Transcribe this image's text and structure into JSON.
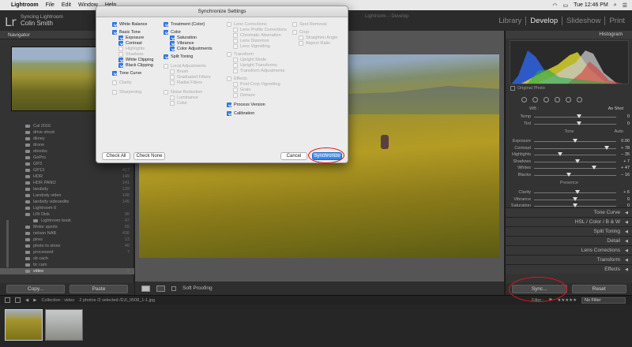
{
  "menubar": {
    "app_name": "Lightroom",
    "items": [
      "File",
      "Edit",
      "Window",
      "Help"
    ],
    "clock": "Tue 12:46 PM"
  },
  "identity": {
    "line1": "Syncing Lightroom",
    "line2": "Colin Smith"
  },
  "window_title_fragment": "Lightroom – Develop",
  "modules": {
    "library": "Library",
    "develop": "Develop",
    "slideshow": "Slideshow",
    "print": "Print"
  },
  "left_panel": {
    "navigator_label": "Navigator",
    "folders": [
      {
        "name": "Cal 2016",
        "count": "",
        "indent": false
      },
      {
        "name": "drive shoot",
        "count": "",
        "indent": false
      },
      {
        "name": "dkney",
        "count": "",
        "indent": false
      },
      {
        "name": "drone",
        "count": "",
        "indent": false
      },
      {
        "name": "ebooks",
        "count": "",
        "indent": false
      },
      {
        "name": "GoPro",
        "count": "",
        "indent": false
      },
      {
        "name": "GP3",
        "count": "",
        "indent": false
      },
      {
        "name": "GP13",
        "count": "417",
        "indent": false
      },
      {
        "name": "HDR",
        "count": "149",
        "indent": false
      },
      {
        "name": "HDR PANO",
        "count": "141",
        "indent": false
      },
      {
        "name": "landsdy",
        "count": "139",
        "indent": false
      },
      {
        "name": "Landsdy video",
        "count": "148",
        "indent": false
      },
      {
        "name": "landsdy videoedits",
        "count": "145",
        "indent": false
      },
      {
        "name": "Lightroom 6",
        "count": "",
        "indent": false
      },
      {
        "name": "LRt Disk",
        "count": "96",
        "indent": false
      },
      {
        "name": "Lightroom book",
        "count": "47",
        "indent": true
      },
      {
        "name": "Motor sports",
        "count": "65",
        "indent": false
      },
      {
        "name": "nelson NAB",
        "count": "436",
        "indent": false
      },
      {
        "name": "pires",
        "count": "13",
        "indent": false
      },
      {
        "name": "photo to show",
        "count": "40",
        "indent": false
      },
      {
        "name": "processed",
        "count": "7",
        "indent": false
      },
      {
        "name": "sb cach",
        "count": "",
        "indent": false
      },
      {
        "name": "tic cam",
        "count": "",
        "indent": false
      },
      {
        "name": "video",
        "count": "2",
        "indent": false,
        "selected": true
      }
    ],
    "copy_button": "Copy...",
    "paste_button": "Paste"
  },
  "toolbar": {
    "soft_proofing": "Soft Proofing"
  },
  "right_panel": {
    "histogram_label": "Histogram",
    "original_photo": "Original Photo",
    "wb_label": "WB :",
    "as_shot": "As Shot",
    "sliders": [
      {
        "label": "Temp",
        "value": "0",
        "pos": 0.55
      },
      {
        "label": "Tint",
        "value": "0",
        "pos": 0.55
      },
      {
        "section": "Tone",
        "auto": "Auto"
      },
      {
        "label": "Exposure",
        "value": "0.00",
        "pos": 0.5
      },
      {
        "label": "Contrast",
        "value": "+ 78",
        "pos": 0.88
      },
      {
        "label": "Highlights",
        "value": "− 35",
        "pos": 0.32
      },
      {
        "label": "Shadows",
        "value": "+ 7",
        "pos": 0.53
      },
      {
        "label": "Whites",
        "value": "+ 47",
        "pos": 0.73
      },
      {
        "label": "Blacks",
        "value": "− 16",
        "pos": 0.42
      },
      {
        "section": "Presence"
      },
      {
        "label": "Clarity",
        "value": "+ 6",
        "pos": 0.53
      },
      {
        "label": "Vibrance",
        "value": "0",
        "pos": 0.5
      },
      {
        "label": "Saturation",
        "value": "0",
        "pos": 0.5
      }
    ],
    "sections": [
      "Tone Curve",
      "HSL / Color / B & W",
      "Split Toning",
      "Detail",
      "Lens Corrections",
      "Transform",
      "Effects"
    ],
    "sync_button": "Sync...",
    "reset_button": "Reset"
  },
  "filmbar": {
    "collection": "Collection : video",
    "selection_info": "2 photos /2 selected /DJI_0508_1-1.jpg",
    "filter_label": "Filter :",
    "filter_value": "No Filter"
  },
  "dialog": {
    "title": "Synchronize Settings",
    "options": [
      {
        "label": "White Balance",
        "checked": true,
        "enabled": true
      },
      {
        "label": "Basic Tone",
        "checked": true,
        "enabled": true
      },
      {
        "label": "Exposure",
        "checked": true,
        "enabled": true
      },
      {
        "label": "Contrast",
        "checked": true,
        "enabled": true
      },
      {
        "label": "Highlights",
        "checked": false,
        "enabled": false
      },
      {
        "label": "Shadows",
        "checked": false,
        "enabled": false
      },
      {
        "label": "White Clipping",
        "checked": true,
        "enabled": true
      },
      {
        "label": "Black Clipping",
        "checked": true,
        "enabled": true
      },
      {
        "label": "Tone Curve",
        "checked": true,
        "enabled": true
      },
      {
        "label": "Clarity",
        "checked": false,
        "enabled": false
      },
      {
        "label": "Sharpening",
        "checked": false,
        "enabled": false
      },
      {
        "label": "Treatment (Color)",
        "checked": true,
        "enabled": true
      },
      {
        "label": "Color",
        "checked": true,
        "enabled": true
      },
      {
        "label": "Saturation",
        "checked": true,
        "enabled": true
      },
      {
        "label": "Vibrance",
        "checked": true,
        "enabled": true
      },
      {
        "label": "Color Adjustments",
        "checked": true,
        "enabled": true
      },
      {
        "label": "Split Toning",
        "checked": true,
        "enabled": true
      },
      {
        "label": "Local Adjustments",
        "checked": false,
        "enabled": false
      },
      {
        "label": "Brush",
        "checked": false,
        "enabled": false
      },
      {
        "label": "Graduated Filters",
        "checked": false,
        "enabled": false
      },
      {
        "label": "Radial Filters",
        "checked": false,
        "enabled": false
      },
      {
        "label": "Noise Reduction",
        "checked": false,
        "enabled": false
      },
      {
        "label": "Luminance",
        "checked": false,
        "enabled": false
      },
      {
        "label": "Color",
        "checked": false,
        "enabled": false
      },
      {
        "label": "Lens Corrections",
        "checked": false,
        "enabled": false
      },
      {
        "label": "Lens Profile Corrections",
        "checked": false,
        "enabled": false
      },
      {
        "label": "Chromatic Aberration",
        "checked": false,
        "enabled": false
      },
      {
        "label": "Lens Distortion",
        "checked": false,
        "enabled": false
      },
      {
        "label": "Lens Vignetting",
        "checked": false,
        "enabled": false
      },
      {
        "label": "Transform",
        "checked": false,
        "enabled": false
      },
      {
        "label": "Upright Mode",
        "checked": false,
        "enabled": false
      },
      {
        "label": "Upright Transforms",
        "checked": false,
        "enabled": false
      },
      {
        "label": "Transform Adjustments",
        "checked": false,
        "enabled": false
      },
      {
        "label": "Effects",
        "checked": false,
        "enabled": false
      },
      {
        "label": "Post-Crop Vignetting",
        "checked": false,
        "enabled": false
      },
      {
        "label": "Grain",
        "checked": false,
        "enabled": false
      },
      {
        "label": "Dehaze",
        "checked": false,
        "enabled": false
      },
      {
        "label": "Process Version",
        "checked": true,
        "enabled": true
      },
      {
        "label": "Calibration",
        "checked": true,
        "enabled": true
      },
      {
        "label": "Spot Removal",
        "checked": false,
        "enabled": false
      },
      {
        "label": "Crop",
        "checked": false,
        "enabled": false
      },
      {
        "label": "Straighten Angle",
        "checked": false,
        "enabled": false
      },
      {
        "label": "Aspect Ratio",
        "checked": false,
        "enabled": false
      }
    ],
    "check_all": "Check All",
    "check_none": "Check None",
    "cancel": "Cancel",
    "synchronize": "Synchronize"
  },
  "colors": {
    "annotation_red": "#e0161a",
    "accent_blue": "#3a84f2"
  }
}
